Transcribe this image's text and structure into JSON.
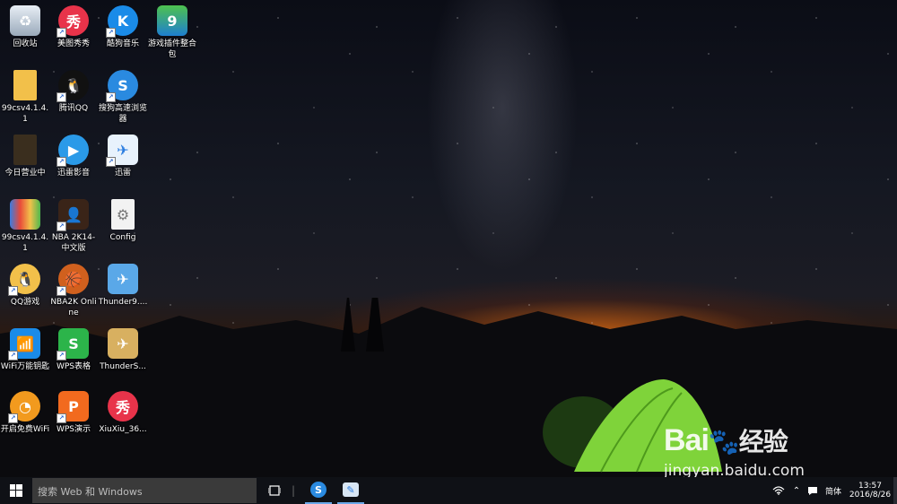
{
  "desktop_icons": [
    {
      "label": "回收站"
    },
    {
      "label": "美图秀秀"
    },
    {
      "label": "酷狗音乐"
    },
    {
      "label": "游戏插件整合包"
    },
    {
      "label": "99csv4.1.4.1"
    },
    {
      "label": "腾讯QQ"
    },
    {
      "label": "搜狗高速浏览器"
    },
    {
      "label": "今日营业中"
    },
    {
      "label": "迅雷影音"
    },
    {
      "label": "迅雷"
    },
    {
      "label": "99csv4.1.4.1"
    },
    {
      "label": "NBA 2K14-中文版"
    },
    {
      "label": "Config"
    },
    {
      "label": "QQ游戏"
    },
    {
      "label": "NBA2K Online"
    },
    {
      "label": "Thunder9...."
    },
    {
      "label": "WiFi万能钥匙"
    },
    {
      "label": "WPS表格"
    },
    {
      "label": "ThunderS..."
    },
    {
      "label": "开启免费WiFi"
    },
    {
      "label": "WPS演示"
    },
    {
      "label": "XiuXiu_36..."
    }
  ],
  "taskbar": {
    "search_placeholder": "搜索 Web 和 Windows",
    "ime_label": "简体",
    "time": "13:57",
    "date": "2016/8/26"
  },
  "watermark": {
    "brand": "Bai",
    "brand_suffix": "经验",
    "url": "jingyan.baidu.com"
  },
  "colors": {
    "taskbar": "#0f1116",
    "tent": "#7fd33a",
    "sky_glow": "#e06a14"
  }
}
